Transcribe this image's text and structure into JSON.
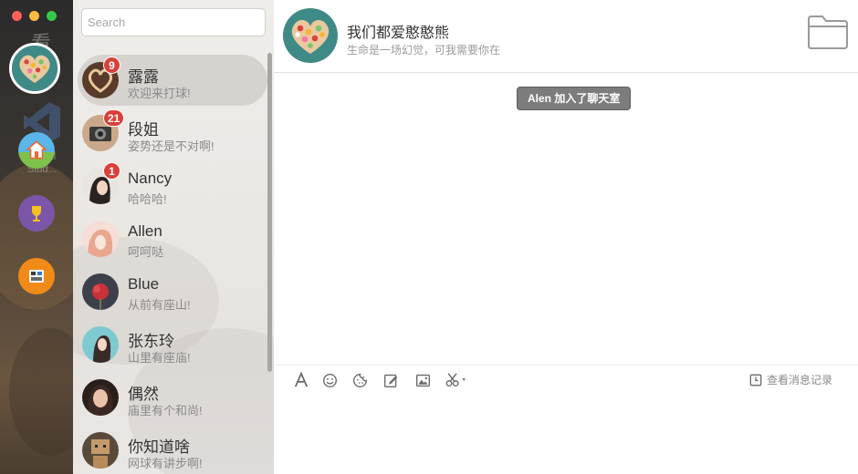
{
  "window": {
    "controls": [
      "close",
      "minimize",
      "maximize"
    ]
  },
  "dock": {
    "background_texts": [
      "看",
      "al",
      "Stud..."
    ],
    "apps": [
      {
        "name": "home-app-icon",
        "color": "#5ab5e8"
      },
      {
        "name": "trophy-app-icon",
        "color": "#7b55a8"
      },
      {
        "name": "film-app-icon",
        "color": "#f08a18"
      }
    ]
  },
  "search": {
    "placeholder": "Search"
  },
  "contacts": [
    {
      "name": "露露",
      "message": "欢迎来打球!",
      "badge": "9",
      "active": true
    },
    {
      "name": "段姐",
      "message": "姿势还是不对啊!",
      "badge": "21"
    },
    {
      "name": "Nancy",
      "message": "哈哈哈!",
      "badge": "1"
    },
    {
      "name": "Allen",
      "message": "呵呵哒"
    },
    {
      "name": "Blue",
      "message": "从前有座山!"
    },
    {
      "name": "张东玲",
      "message": "山里有座庙!"
    },
    {
      "name": "偶然",
      "message": "庙里有个和尚!"
    },
    {
      "name": "你知道啥",
      "message": "网球有讲步啊!"
    }
  ],
  "chat": {
    "title": "我们都爱憨憨熊",
    "subtitle": "生命是一场幻觉，可我需要你在",
    "system_message": "Alen 加入了聊天室",
    "history_label": "查看消息记录",
    "toolbar": [
      "font-icon",
      "emoji-icon",
      "sticker-icon",
      "edit-icon",
      "image-icon",
      "scissors-icon"
    ]
  },
  "colors": {
    "badge": "#d9403a",
    "active_row": "#d6d3cf",
    "system_message_bg": "#7c7c7c"
  }
}
